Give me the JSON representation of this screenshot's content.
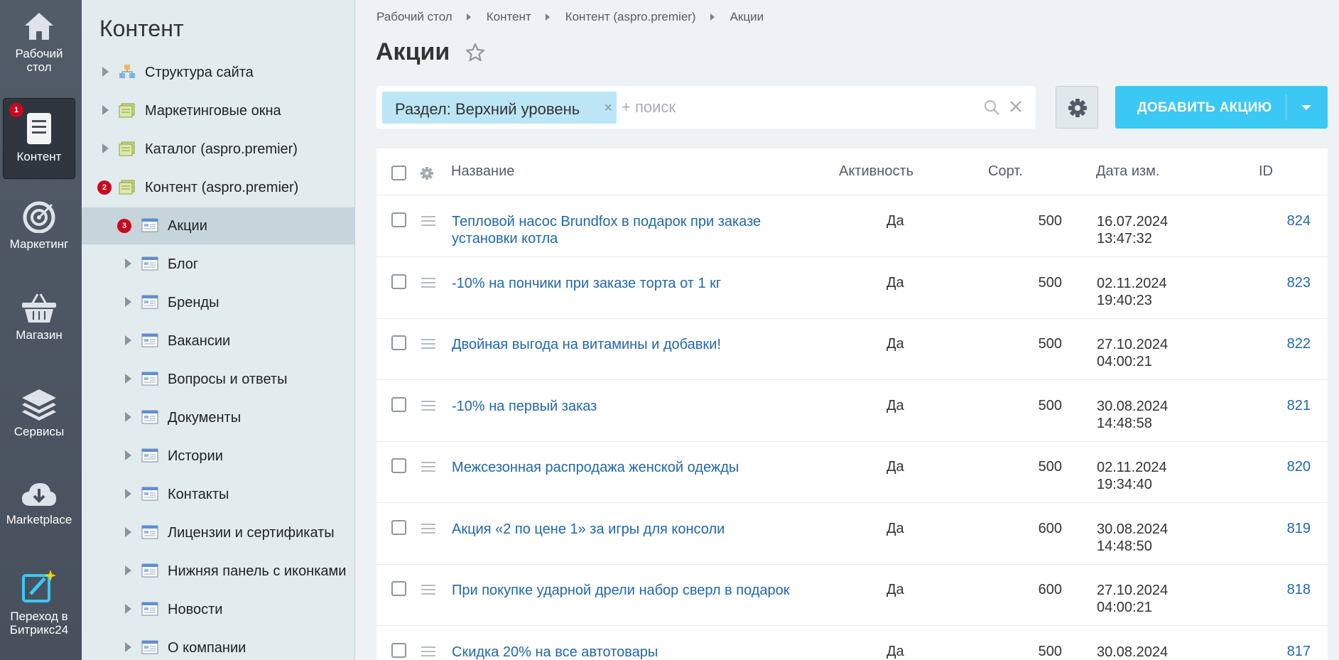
{
  "rail": {
    "items": [
      {
        "label": "Рабочий стол",
        "icon": "house-icon"
      },
      {
        "label": "Контент",
        "icon": "document-icon",
        "badge": "1",
        "active": true
      },
      {
        "label": "Маркетинг",
        "icon": "target-icon"
      },
      {
        "label": "Магазин",
        "icon": "basket-icon"
      },
      {
        "label": "Сервисы",
        "icon": "layers-icon"
      },
      {
        "label": "Marketplace",
        "icon": "cloud-download-icon"
      },
      {
        "label": "Переход в Битрикс24",
        "icon": "magic-edit-icon"
      }
    ]
  },
  "tree": {
    "title": "Контент",
    "items": [
      {
        "label": "Структура сайта",
        "level": 0
      },
      {
        "label": "Маркетинговые окна",
        "level": 0
      },
      {
        "label": "Каталог (aspro.premier)",
        "level": 0
      },
      {
        "label": "Контент (aspro.premier)",
        "level": 0,
        "badge": "2"
      },
      {
        "label": "Акции",
        "level": 1,
        "badge": "3",
        "selected": true
      },
      {
        "label": "Блог",
        "level": 1
      },
      {
        "label": "Бренды",
        "level": 1
      },
      {
        "label": "Вакансии",
        "level": 1
      },
      {
        "label": "Вопросы и ответы",
        "level": 1
      },
      {
        "label": "Документы",
        "level": 1
      },
      {
        "label": "Истории",
        "level": 1
      },
      {
        "label": "Контакты",
        "level": 1
      },
      {
        "label": "Лицензии и сертификаты",
        "level": 1
      },
      {
        "label": "Нижняя панель с иконками",
        "level": 1
      },
      {
        "label": "Новости",
        "level": 1
      },
      {
        "label": "О компании",
        "level": 1
      }
    ]
  },
  "breadcrumb": [
    "Рабочий стол",
    "Контент",
    "Контент (aspro.premier)",
    "Акции"
  ],
  "page": {
    "title": "Акции"
  },
  "filter": {
    "tag_label": "Раздел: Верхний уровень",
    "tag_close": "×",
    "placeholder": "+ поиск"
  },
  "add_button": {
    "label": "ДОБАВИТЬ АКЦИЮ"
  },
  "table": {
    "columns": {
      "name": "Название",
      "active": "Активность",
      "sort": "Сорт.",
      "date": "Дата изм.",
      "id": "ID"
    },
    "rows": [
      {
        "name": "Тепловой насос Brundfox в подарок при заказе установки котла",
        "active": "Да",
        "sort": "500",
        "date": "16.07.2024 13:47:32",
        "id": "824"
      },
      {
        "name": "-10% на пончики при заказе торта от 1 кг",
        "active": "Да",
        "sort": "500",
        "date": "02.11.2024 19:40:23",
        "id": "823"
      },
      {
        "name": "Двойная выгода на витамины и добавки!",
        "active": "Да",
        "sort": "500",
        "date": "27.10.2024 04:00:21",
        "id": "822"
      },
      {
        "name": "-10% на первый заказ",
        "active": "Да",
        "sort": "500",
        "date": "30.08.2024 14:48:58",
        "id": "821"
      },
      {
        "name": "Межсезонная распродажа женской одежды",
        "active": "Да",
        "sort": "500",
        "date": "02.11.2024 19:34:40",
        "id": "820"
      },
      {
        "name": "Акция «2 по цене 1» за игры для консоли",
        "active": "Да",
        "sort": "600",
        "date": "30.08.2024 14:48:50",
        "id": "819"
      },
      {
        "name": "При покупке ударной дрели набор сверл в подарок",
        "active": "Да",
        "sort": "600",
        "date": "27.10.2024 04:00:21",
        "id": "818"
      },
      {
        "name": "Скидка 20% на все автотовары",
        "active": "Да",
        "sort": "500",
        "date": "30.08.2024",
        "id": "817"
      }
    ]
  }
}
